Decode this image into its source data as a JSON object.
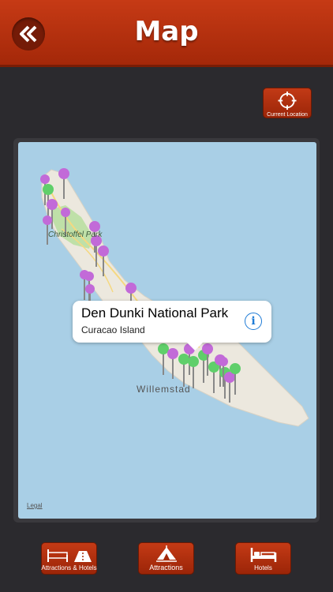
{
  "header": {
    "title": "Map",
    "back_icon": "double-chevron-left-icon"
  },
  "current_location": {
    "label": "Current Location",
    "icon": "crosshair-icon"
  },
  "map": {
    "park_label": "Christoffel Park",
    "city_label": "Willemstad",
    "legal_label": "Legal",
    "callout": {
      "title": "Den Dunki National Park",
      "subtitle": "Curacao Island",
      "info_symbol": "i"
    }
  },
  "bottom_bar": {
    "attractions_hotels": {
      "label": "Attractions & Hotels",
      "icon": "bed-and-road-icon"
    },
    "attractions": {
      "label": "Attractions",
      "icon": "tent-icon"
    },
    "hotels": {
      "label": "Hotels",
      "icon": "bed-icon"
    }
  },
  "colors": {
    "accent": "#b2300f",
    "background": "#2b2a2e",
    "water": "#a9cfe6",
    "pin_purple": "#c26ad8",
    "pin_green": "#5fcf6a"
  }
}
